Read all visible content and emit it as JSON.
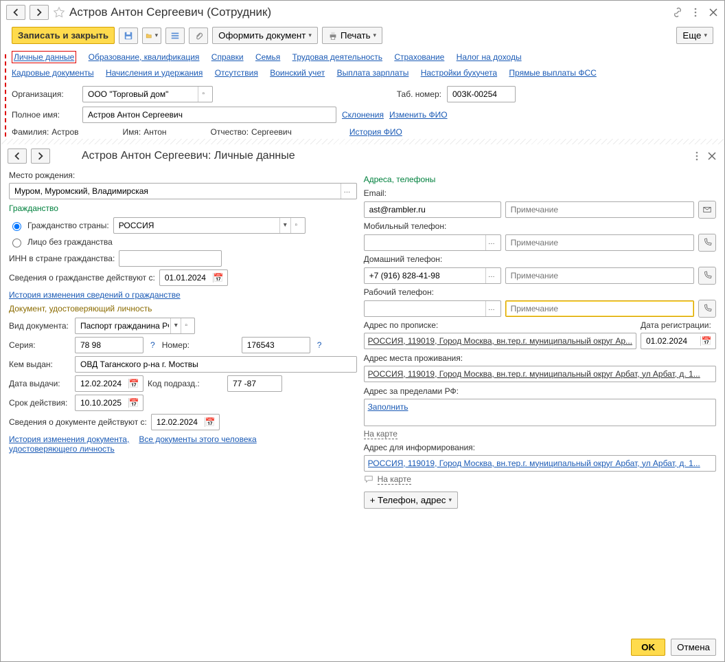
{
  "header": {
    "title": "Астров Антон Сергеевич (Сотрудник)"
  },
  "toolbar": {
    "save_close": "Записать и закрыть",
    "document_btn": "Оформить документ",
    "print_btn": "Печать",
    "more_btn": "Еще"
  },
  "tabs": {
    "personal": "Личные данные",
    "education": "Образование, квалификация",
    "references": "Справки",
    "family": "Семья",
    "work": "Трудовая деятельность",
    "insurance": "Страхование",
    "tax": "Налог на доходы",
    "hr_docs": "Кадровые документы",
    "accruals": "Начисления и удержания",
    "absences": "Отсутствия",
    "military": "Воинский учет",
    "salary": "Выплата зарплаты",
    "accounting": "Настройки бухучета",
    "fss": "Прямые выплаты ФСС"
  },
  "main_form": {
    "org_label": "Организация:",
    "org_value": "ООО \"Торговый дом\"",
    "tab_num_label": "Таб. номер:",
    "tab_num_value": "00ЗК-00254",
    "full_name_label": "Полное имя:",
    "full_name_value": "Астров Антон Сергеевич",
    "declension_link": "Склонения",
    "change_fio_link": "Изменить ФИО",
    "surname_label": "Фамилия:",
    "surname_value": "Астров",
    "name_label": "Имя:",
    "name_value": "Антон",
    "patronymic_label": "Отчество:",
    "patronymic_value": "Сергеевич",
    "history_fio_link": "История ФИО"
  },
  "sub": {
    "title": "Астров Антон Сергеевич: Личные данные",
    "birthplace_label": "Место рождения:",
    "birthplace_value": "Муром, Муромский, Владимирская",
    "citizenship_header": "Гражданство",
    "citizenship_country_label": "Гражданство страны:",
    "citizenship_country_value": "РОССИЯ",
    "stateless_label": "Лицо без гражданства",
    "inn_label": "ИНН в стране гражданства:",
    "citizenship_date_label": "Сведения о гражданстве действуют с:",
    "citizenship_date_value": "01.01.2024",
    "citizenship_history_link": "История изменения сведений о гражданстве",
    "doc_header": "Документ, удостоверяющий личность",
    "doc_type_label": "Вид документа:",
    "doc_type_value": "Паспорт гражданина РФ",
    "series_label": "Серия:",
    "series_value": "78 98",
    "number_label": "Номер:",
    "number_value": "176543",
    "issued_by_label": "Кем выдан:",
    "issued_by_value": "ОВД Таганского р-на г. Моствы",
    "issue_date_label": "Дата выдачи:",
    "issue_date_value": "12.02.2024",
    "code_label": "Код подразд.:",
    "code_value": "77 -87",
    "validity_label": "Срок действия:",
    "validity_value": "10.10.2025",
    "doc_date_label": "Сведения о документе действуют с:",
    "doc_date_value": "12.02.2024",
    "doc_history_link": "История изменения документа,\nудостоверяющего личность",
    "doc_history_part1": "История изменения документа,",
    "doc_history_part2": "удостоверяющего личность",
    "all_docs_link": "Все документы этого человека",
    "contacts_header": "Адреса, телефоны",
    "email_label": "Email:",
    "email_value": "ast@rambler.ru",
    "note_placeholder": "Примечание",
    "mobile_label": "Мобильный телефон:",
    "home_label": "Домашний телефон:",
    "home_value": "+7 (916) 828-41-98",
    "work_phone_label": "Рабочий телефон:",
    "reg_addr_label": "Адрес по прописке:",
    "reg_date_label": "Дата регистрации:",
    "reg_date_value": "01.02.2024",
    "reg_addr_value": "РОССИЯ, 119019, Город Москва, вн.тер.г. муниципальный округ Ар...",
    "live_addr_label": "Адрес места проживания:",
    "live_addr_value": "РОССИЯ, 119019, Город Москва, вн.тер.г. муниципальный округ Арбат, ул Арбат, д. 1...",
    "foreign_addr_label": "Адрес за пределами РФ:",
    "fill_link": "Заполнить",
    "map_link": "На карте",
    "inform_addr_label": "Адрес для информирования:",
    "inform_addr_value": "РОССИЯ, 119019, Город Москва, вн.тер.г. муниципальный округ Арбат, ул Арбат, д. 1...",
    "add_contact_btn": "+ Телефон, адрес"
  },
  "footer": {
    "ok": "OK",
    "cancel": "Отмена"
  }
}
